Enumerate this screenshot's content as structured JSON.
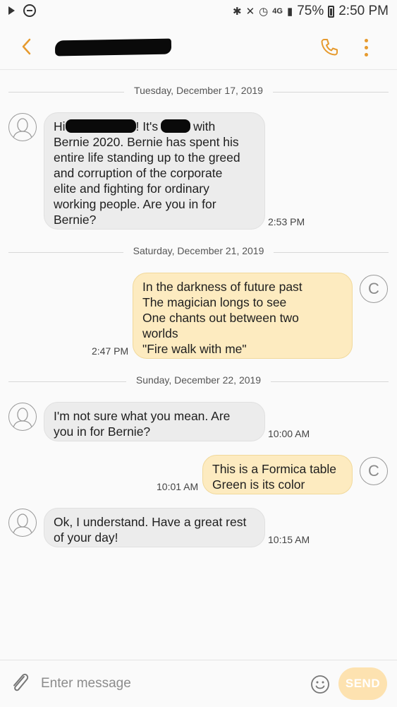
{
  "status_bar": {
    "network": "4G",
    "battery": "75%",
    "time": "2:50 PM"
  },
  "header": {
    "contact_name_redacted": true
  },
  "conversation": {
    "date1": "Tuesday, December 17, 2019",
    "msg1": {
      "pre": "Hi",
      "mid": "! It's",
      "post": "with",
      "rest": "Bernie 2020. Bernie has spent his\nentire life standing up to the greed\nand corruption of the corporate\nelite and fighting for ordinary\nworking people. Are you in for\nBernie?",
      "time": "2:53 PM"
    },
    "date2": "Saturday, December 21, 2019",
    "msg2": {
      "text": "In the darkness of future past\nThe magician longs to see\nOne chants out between two\nworlds\n\"Fire walk with me\"",
      "time": "2:47 PM",
      "avatar_letter": "C"
    },
    "date3": "Sunday, December 22, 2019",
    "msg3": {
      "text": "I'm not sure what you mean. Are\nyou in for Bernie?",
      "time": "10:00 AM"
    },
    "msg4": {
      "text": "This is a Formica table\nGreen is its color",
      "time": "10:01 AM",
      "avatar_letter": "C"
    },
    "msg5": {
      "text": "Ok, I understand. Have a great rest\nof your day!",
      "time": "10:15 AM"
    }
  },
  "composer": {
    "placeholder": "Enter message",
    "send_label": "SEND"
  },
  "colors": {
    "accent": "#e69a2e",
    "incoming_bubble": "#ececec",
    "outgoing_bubble": "#fdebc0",
    "send_button": "#fde2b0"
  }
}
